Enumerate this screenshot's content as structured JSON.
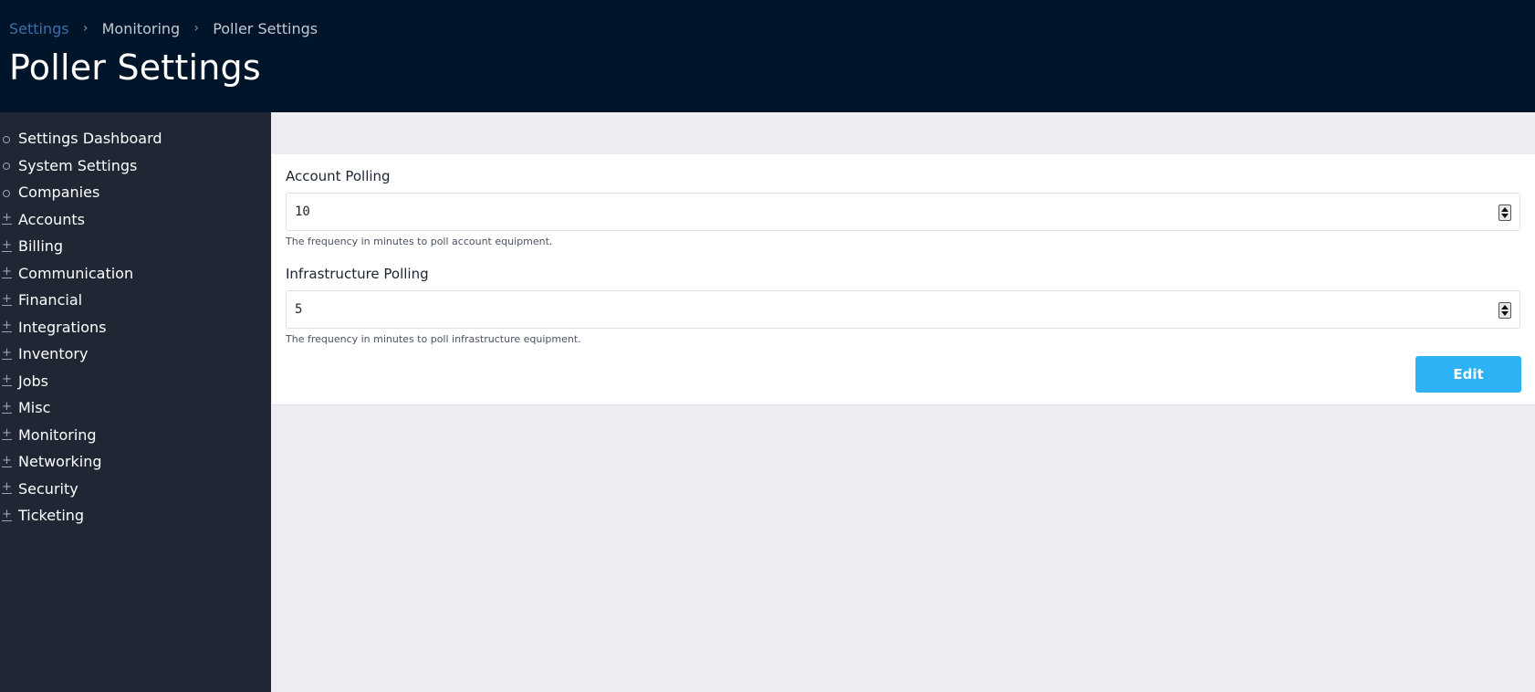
{
  "breadcrumb": {
    "items": [
      "Settings",
      "Monitoring",
      "Poller Settings"
    ],
    "separator_icon": "chevron-right-icon"
  },
  "page_title": "Poller Settings",
  "sidebar": {
    "items": [
      {
        "label": "Settings Dashboard",
        "icon": "circle-icon"
      },
      {
        "label": "System Settings",
        "icon": "circle-icon"
      },
      {
        "label": "Companies",
        "icon": "circle-icon"
      },
      {
        "label": "Accounts",
        "icon": "plus-icon"
      },
      {
        "label": "Billing",
        "icon": "plus-icon"
      },
      {
        "label": "Communication",
        "icon": "plus-icon"
      },
      {
        "label": "Financial",
        "icon": "plus-icon"
      },
      {
        "label": "Integrations",
        "icon": "plus-icon"
      },
      {
        "label": "Inventory",
        "icon": "plus-icon"
      },
      {
        "label": "Jobs",
        "icon": "plus-icon"
      },
      {
        "label": "Misc",
        "icon": "plus-icon"
      },
      {
        "label": "Monitoring",
        "icon": "plus-icon"
      },
      {
        "label": "Networking",
        "icon": "plus-icon"
      },
      {
        "label": "Security",
        "icon": "plus-icon"
      },
      {
        "label": "Ticketing",
        "icon": "plus-icon"
      }
    ]
  },
  "form": {
    "account_polling": {
      "label": "Account Polling",
      "value": "10",
      "help": "The frequency in minutes to poll account equipment."
    },
    "infrastructure_polling": {
      "label": "Infrastructure Polling",
      "value": "5",
      "help": "The frequency in minutes to poll infrastructure equipment."
    },
    "edit_label": "Edit"
  },
  "colors": {
    "header_bg": "#00152a",
    "sidebar_bg": "#1f2735",
    "content_bg": "#edeef2",
    "accent": "#2eb2f6",
    "breadcrumb_link": "#3c6fa8"
  }
}
